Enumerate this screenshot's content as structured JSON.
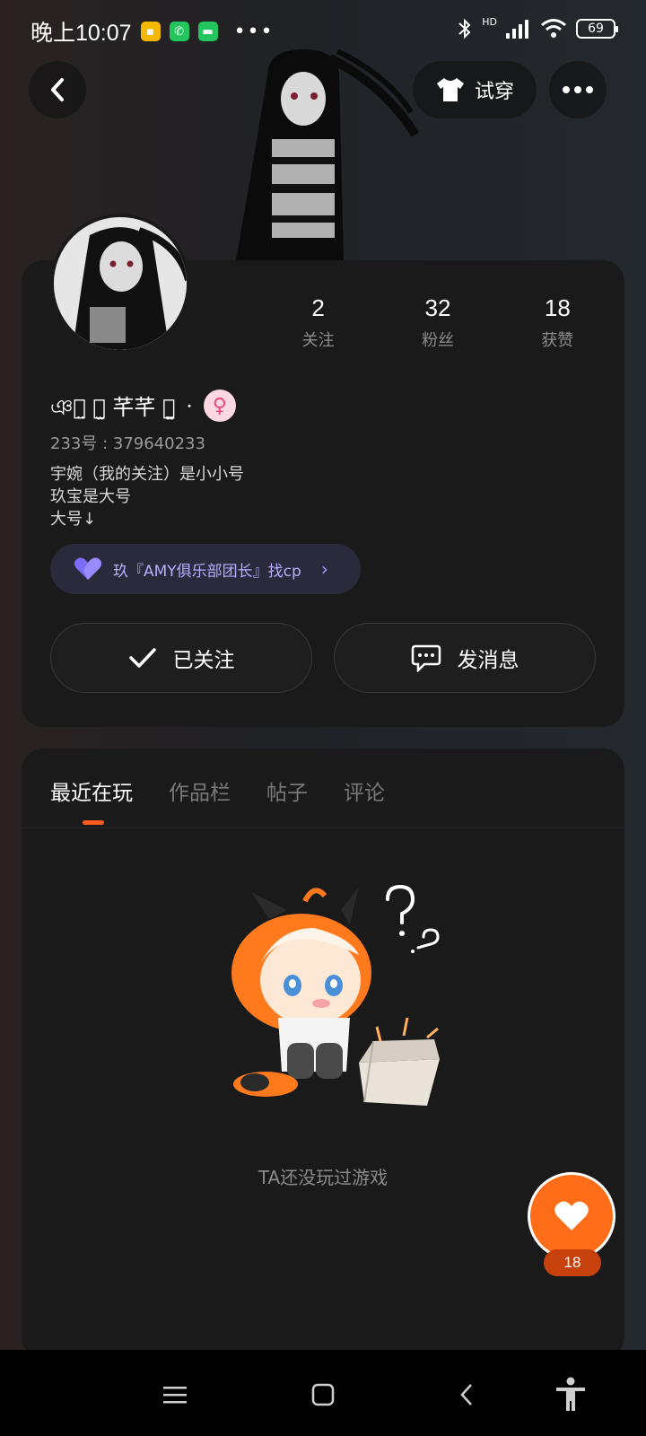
{
  "status_bar": {
    "time": "晚上10:07",
    "more": "•••",
    "network": "HD",
    "battery": "69"
  },
  "header": {
    "try_on_label": "试穿"
  },
  "profile": {
    "nickname": "ঞ᠂̤ ⃘̫ 芊芊 ⃘̫̤ ᠂",
    "gender_symbol": "♀",
    "id_label": "233号 : 379640233",
    "bio_lines": [
      "宇婉（我的关注）是小小号",
      "玖宝是大号",
      "大号↓"
    ],
    "cp_text": "玖『AMY俱乐部团长』找cp",
    "stats": [
      {
        "value": "2",
        "label": "关注"
      },
      {
        "value": "32",
        "label": "粉丝"
      },
      {
        "value": "18",
        "label": "获赞"
      }
    ],
    "follow_button": "已关注",
    "message_button": "发消息"
  },
  "tabs": [
    {
      "label": "最近在玩",
      "active": true
    },
    {
      "label": "作品栏",
      "active": false
    },
    {
      "label": "帖子",
      "active": false
    },
    {
      "label": "评论",
      "active": false
    }
  ],
  "empty_state": {
    "text": "TA还没玩过游戏"
  },
  "like": {
    "count": "18"
  },
  "colors": {
    "accent": "#ff6d18",
    "tab_indicator": "#ff5a1f",
    "cp_text": "#b5b0ff",
    "card_bg": "#1a1a1b"
  },
  "icons": [
    "back-icon",
    "shirt-icon",
    "more-icon",
    "heart-icon",
    "check-icon",
    "message-icon",
    "menu-icon",
    "home-icon",
    "nav-back-icon",
    "accessibility-icon"
  ]
}
